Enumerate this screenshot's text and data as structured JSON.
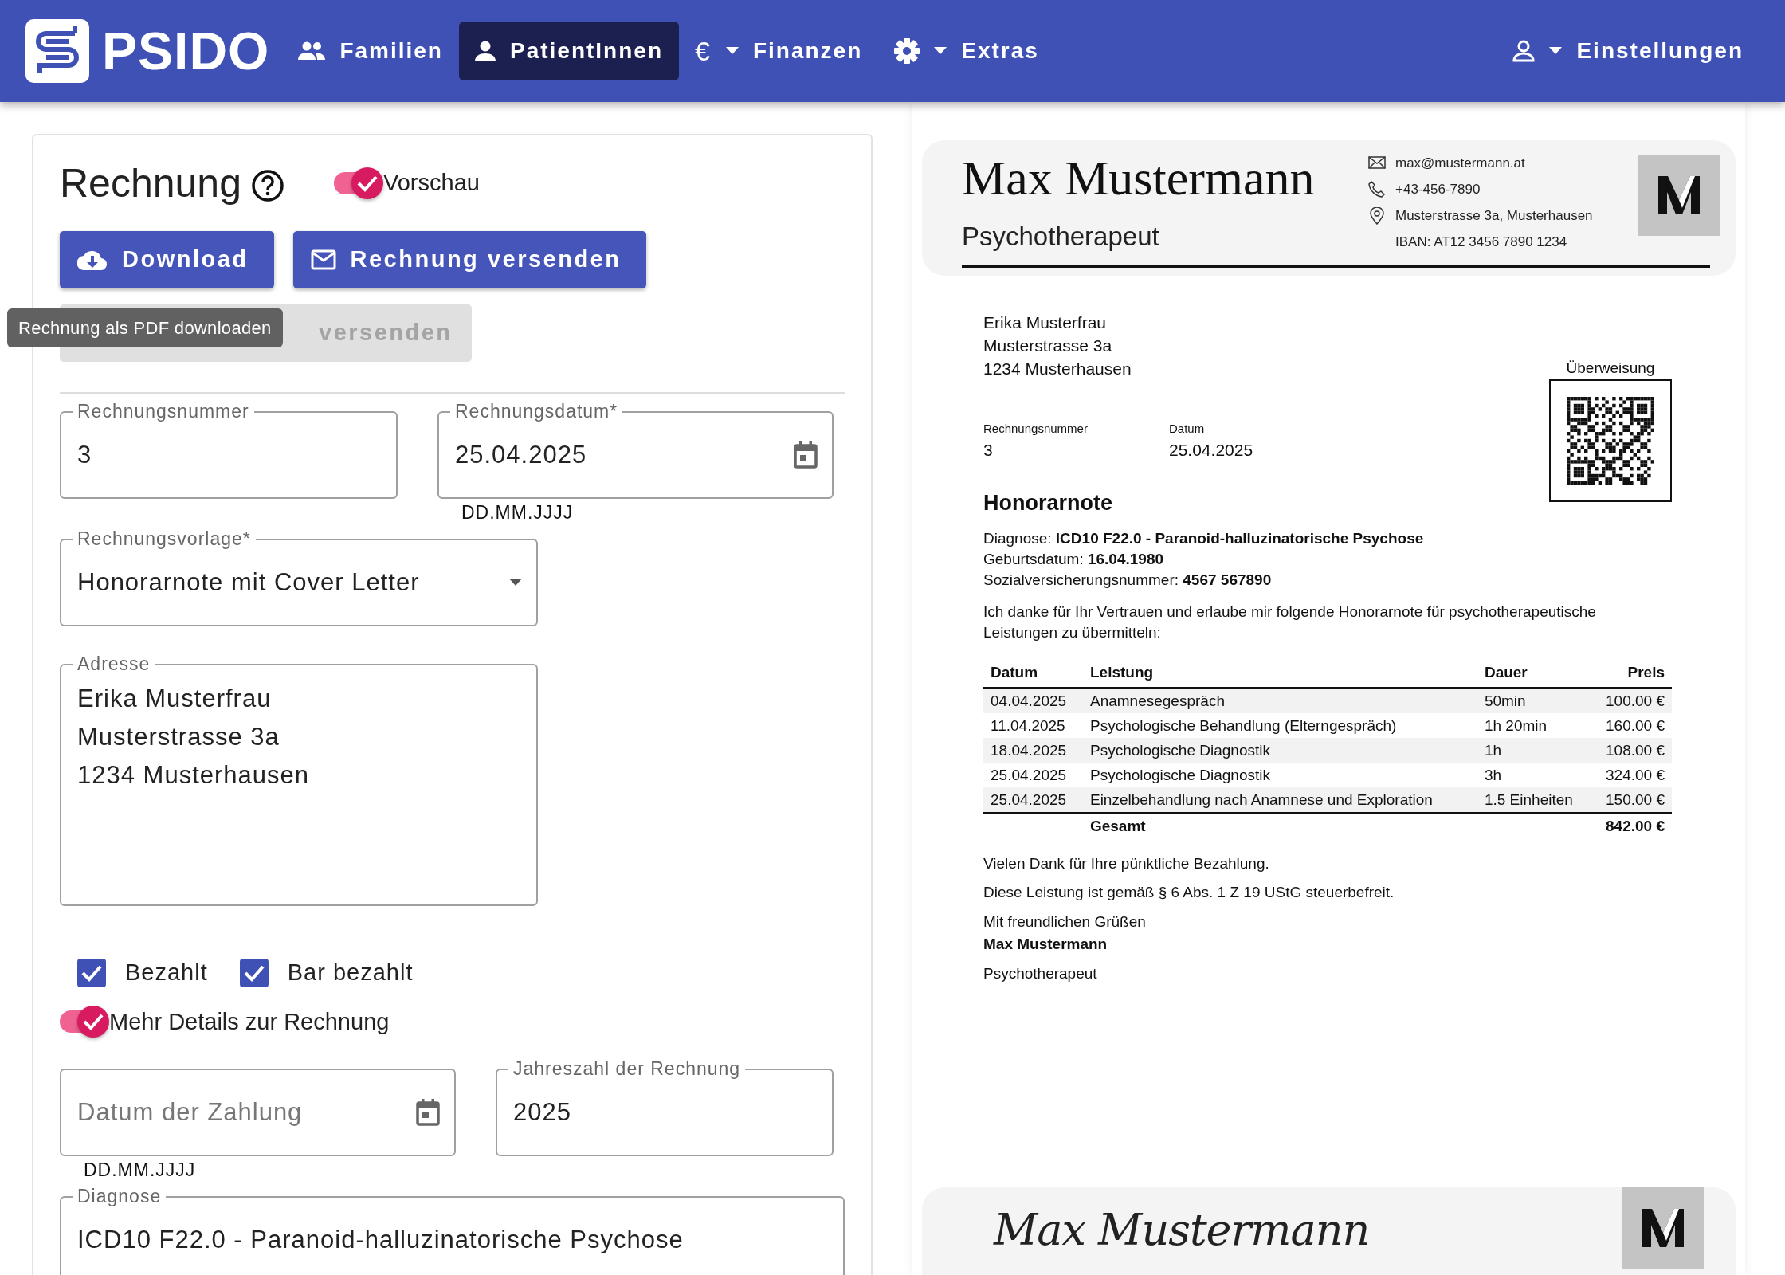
{
  "navbar": {
    "brand": "PSIDO",
    "items": [
      {
        "label": "Familien",
        "dropdown": false,
        "selected": false
      },
      {
        "label": "PatientInnen",
        "dropdown": false,
        "selected": true
      },
      {
        "label": "Finanzen",
        "glyph": "€",
        "dropdown": true,
        "selected": false
      },
      {
        "label": "Extras",
        "dropdown": true,
        "selected": false
      }
    ],
    "account": {
      "label": "Einstellungen",
      "dropdown": true
    }
  },
  "form": {
    "title": "Rechnung",
    "preview_toggle": {
      "label": "Vorschau",
      "on": true
    },
    "buttons": [
      {
        "label": "Download",
        "disabled": false
      },
      {
        "label": "Rechnung versenden",
        "disabled": false
      },
      {
        "label": "versenden",
        "disabled": true
      }
    ],
    "tooltip": "Rechnung als PDF downloaden",
    "field_rows": [
      [
        {
          "kind": "text",
          "label": "Rechnungsnummer",
          "value": "3"
        },
        {
          "kind": "date",
          "label": "Rechnungsdatum*",
          "value": "25.04.2025",
          "helper": "DD.MM.JJJJ"
        }
      ],
      [
        {
          "kind": "select",
          "label": "Rechnungsvorlage*",
          "value": "Honorarnote mit Cover Letter"
        }
      ],
      [
        {
          "kind": "textarea",
          "label": "Adresse",
          "value": [
            "Erika Musterfrau",
            "Musterstrasse 3a",
            "1234 Musterhausen"
          ]
        }
      ]
    ],
    "checkboxes": [
      {
        "label": "Bezahlt",
        "checked": true
      },
      {
        "label": "Bar bezahlt",
        "checked": true
      }
    ],
    "details_toggle": {
      "label": "Mehr Details zur Rechnung",
      "on": true
    },
    "detail_rows": [
      [
        {
          "kind": "date",
          "placeholder": "Datum der Zahlung",
          "helper": "DD.MM.JJJJ"
        },
        {
          "kind": "text",
          "label": "Jahreszahl der Rechnung",
          "value": "2025"
        }
      ],
      [
        {
          "kind": "text",
          "label": "Diagnose",
          "value": "ICD10 F22.0 - Paranoid-halluzinatorische Psychose"
        }
      ]
    ]
  },
  "invoice": {
    "header": {
      "name": "Max Mustermann",
      "title": "Psychotherapeut",
      "contacts": [
        "max@mustermann.at",
        "+43-456-7890",
        "Musterstrasse 3a, Musterhausen",
        "IBAN: AT12 3456 7890 1234"
      ]
    },
    "recipient": [
      "Erika Musterfrau",
      "Musterstrasse 3a",
      "1234 Musterhausen"
    ],
    "meta": [
      {
        "label": "Rechnungsnummer",
        "value": "3"
      },
      {
        "label": "Datum",
        "value": "25.04.2025"
      }
    ],
    "qr_label": "Überweisung",
    "heading": "Honorarnote",
    "details": [
      "Diagnose: **ICD10 F22.0 - Paranoid-halluzinatorische Psychose**",
      "Geburtsdatum: **16.04.1980**",
      "Sozialversicherungsnummer: **4567 567890**"
    ],
    "intro": "Ich danke für Ihr Vertrauen und erlaube mir folgende Honorarnote für psychotherapeutische Leistungen zu übermitteln:",
    "table": {
      "columns": [
        "Datum",
        "Leistung",
        "Dauer",
        "Preis"
      ],
      "rows": [
        [
          "04.04.2025",
          "Anamnesegespräch",
          "50min",
          "100.00 €"
        ],
        [
          "11.04.2025",
          "Psychologische Behandlung (Elterngespräch)",
          "1h 20min",
          "160.00 €"
        ],
        [
          "18.04.2025",
          "Psychologische Diagnostik",
          "1h",
          "108.00 €"
        ],
        [
          "25.04.2025",
          "Psychologische Diagnostik",
          "3h",
          "324.00 €"
        ],
        [
          "25.04.2025",
          "Einzelbehandlung nach Anamnese und Exploration",
          "1.5 Einheiten",
          "150.00 €"
        ]
      ],
      "total": {
        "label": "Gesamt",
        "value": "842.00 €"
      }
    },
    "closing": [
      "Vielen Dank für Ihre pünktliche Bezahlung.",
      "Diese Leistung ist gemäß § 6 Abs. 1 Z 19 UStG steuerbefreit."
    ],
    "greeting": "Mit freundlichen Grüßen",
    "signer_name": "Max Mustermann",
    "signer_title": "Psychotherapeut",
    "signature": "Max Mustermann"
  }
}
